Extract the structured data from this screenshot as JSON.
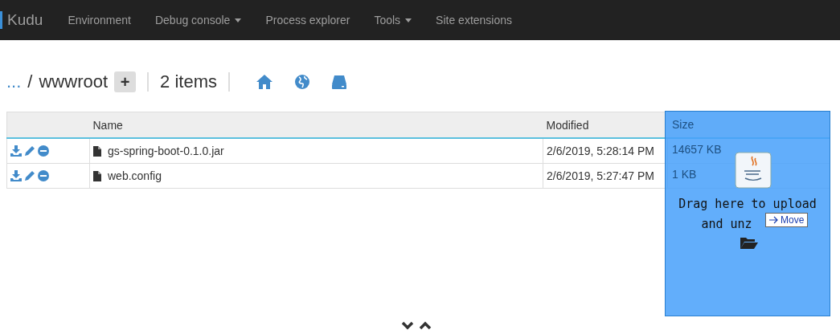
{
  "nav": {
    "brand": "Kudu",
    "items": [
      {
        "label": "Environment",
        "dropdown": false
      },
      {
        "label": "Debug console",
        "dropdown": true
      },
      {
        "label": "Process explorer",
        "dropdown": false
      },
      {
        "label": "Tools",
        "dropdown": true
      },
      {
        "label": "Site extensions",
        "dropdown": false
      }
    ]
  },
  "breadcrumb": {
    "parent": "...",
    "separator": "/",
    "current": "wwwroot",
    "add": "+",
    "count": "2 items"
  },
  "table": {
    "columns": [
      "Name",
      "Modified",
      "Size"
    ],
    "rows": [
      {
        "name": "gs-spring-boot-0.1.0.jar",
        "modified": "2/6/2019, 5:28:14 PM",
        "size": "14657 KB"
      },
      {
        "name": "web.config",
        "modified": "2/6/2019, 5:27:47 PM",
        "size": "1 KB"
      }
    ]
  },
  "drop_zone": {
    "lines": [
      "Drag here to upload",
      "and unz"
    ],
    "tooltip": "Move"
  }
}
